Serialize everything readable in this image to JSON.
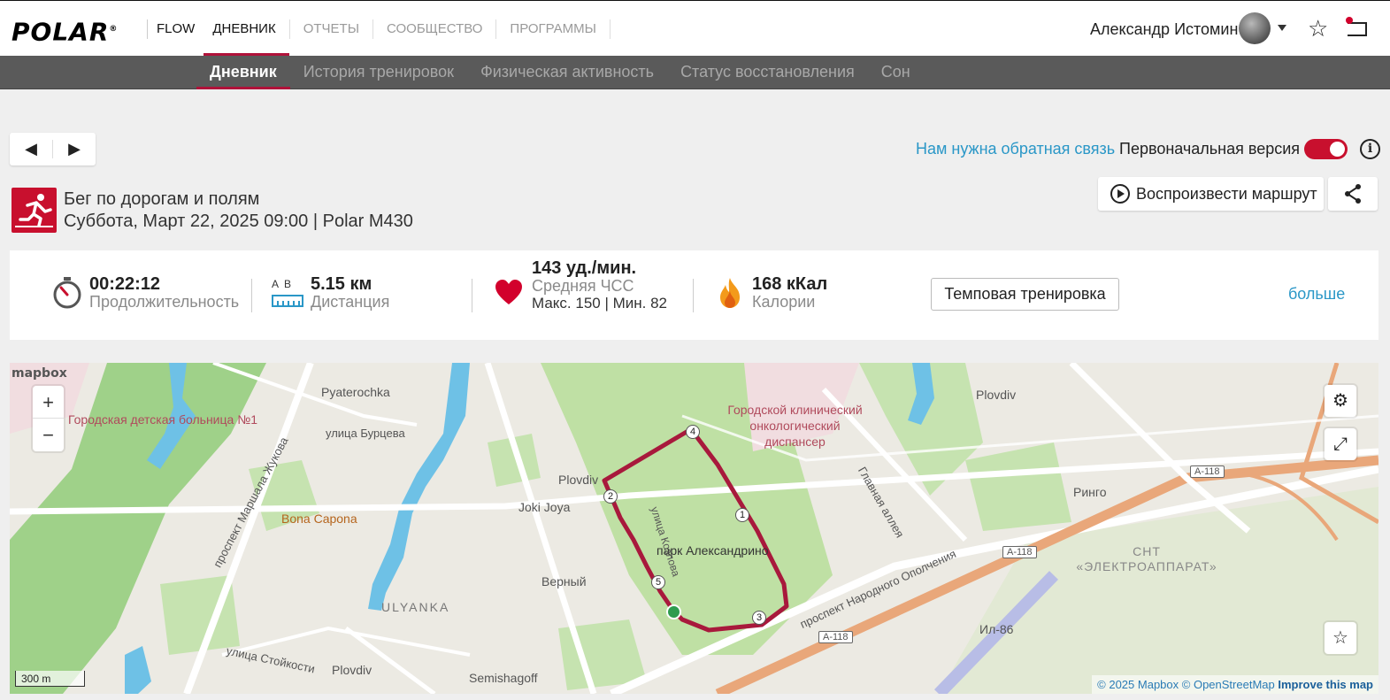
{
  "brand": {
    "logo": "POLAR",
    "flow": "FLOW"
  },
  "top_nav": [
    {
      "label": "ДНЕВНИК",
      "active": true
    },
    {
      "label": "ОТЧЕТЫ",
      "active": false
    },
    {
      "label": "СООБЩЕСТВО",
      "active": false
    },
    {
      "label": "ПРОГРАММЫ",
      "active": false
    }
  ],
  "user": {
    "name": "Александр Истомин"
  },
  "sub_nav": [
    {
      "label": "Дневник",
      "active": true
    },
    {
      "label": "История тренировок",
      "active": false
    },
    {
      "label": "Физическая активность",
      "active": false
    },
    {
      "label": "Статус восстановления",
      "active": false
    },
    {
      "label": "Сон",
      "active": false
    }
  ],
  "controls": {
    "prev": "◀",
    "next": "▶",
    "feedback": "Нам нужна обратная связь",
    "version": "Первоначальная версия",
    "version_toggle_on": true
  },
  "session": {
    "title": "Бег по дорогам и полям",
    "subtitle": "Суббота, Март 22, 2025 09:00 | Polar M430",
    "replay": "Воспроизвести маршрут",
    "sport_color": "#c8102e"
  },
  "summary": {
    "duration": {
      "value": "00:22:12",
      "label": "Продолжительность"
    },
    "distance": {
      "value": "5.15 км",
      "label": "Дистанция",
      "icon_ab": "A  B"
    },
    "heart_rate": {
      "value": "143 уд./мин.",
      "label": "Средняя ЧСС",
      "sub": "Макс. 150  |  Мин. 82"
    },
    "calories": {
      "value": "168 кКал",
      "label": "Калории"
    },
    "tempo_button": "Темповая тренировка",
    "more": "больше"
  },
  "map": {
    "labels": {
      "hospital1": "Городская детская больница №1",
      "pyaterochka": "Pyaterochka",
      "burtseva": "улица Бурцева",
      "zhukova": "проспект Маршала Жукова",
      "bona": "Bona Capona",
      "joki": "Joki Joya",
      "plovdiv1": "Plovdiv",
      "verny": "Верный",
      "ulyanka": "ULYANKA",
      "stoykosti": "улица Стойкости",
      "plovdiv2": "Plovdiv",
      "semishagoff": "Semishagoff",
      "park": "парк Александрино",
      "hospital2": "Городской клинический онкологический диспансер",
      "glavnaya": "Главная аллея",
      "plovdiv3": "Plovdiv",
      "ringo": "Ринго",
      "opolcheniya": "проспект Народного Ополчения",
      "snt": "СНТ «ЭЛЕКТРОАППАРАТ»",
      "il86": "Ил-86",
      "a118a": "А-118",
      "a118b": "А-118",
      "a118c": "А-118",
      "street_route": "улица Козлова"
    },
    "route_markers": [
      "1",
      "2",
      "3",
      "4",
      "5"
    ],
    "scale": "300 m",
    "attribution": {
      "mapbox": "© 2025 Mapbox",
      "osm": "© OpenStreetMap",
      "improve": "Improve this map"
    },
    "mapbox_logo": "mapbox",
    "zoom_in": "+",
    "zoom_out": "−",
    "route_color": "#a8193c"
  }
}
